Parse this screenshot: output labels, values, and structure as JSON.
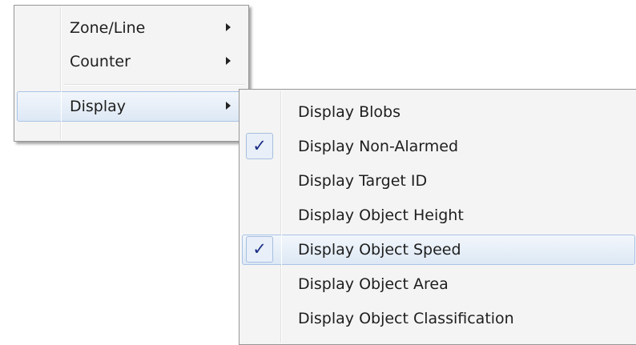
{
  "menu": {
    "items": [
      {
        "label": "Zone/Line",
        "has_submenu": true
      },
      {
        "label": "Counter",
        "has_submenu": true
      },
      {
        "label": "Display",
        "has_submenu": true,
        "highlighted": true
      }
    ]
  },
  "submenu": {
    "items": [
      {
        "label": "Display Blobs",
        "checked": false
      },
      {
        "label": "Display Non-Alarmed",
        "checked": true
      },
      {
        "label": "Display Target ID",
        "checked": false
      },
      {
        "label": "Display Object Height",
        "checked": false
      },
      {
        "label": "Display Object Speed",
        "checked": true,
        "highlighted": true
      },
      {
        "label": "Display Object Area",
        "checked": false
      },
      {
        "label": "Display Object Classification",
        "checked": false
      }
    ]
  },
  "icons": {
    "check": "✓",
    "submenu_arrow": "triangle-right"
  },
  "colors": {
    "highlight_border": "#a9c3e6",
    "check_mark": "#1b2d86"
  }
}
